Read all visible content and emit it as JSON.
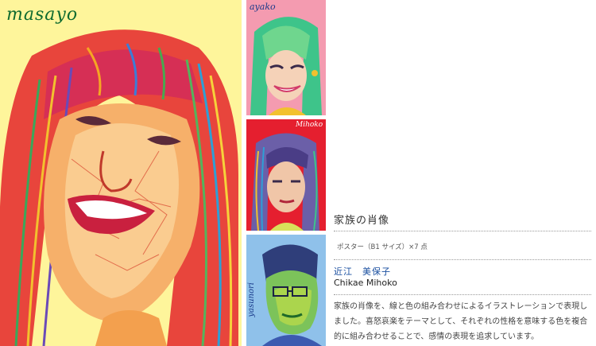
{
  "artworks": {
    "main_signature": "masayo",
    "panel1_signature": "ayako",
    "panel2_signature": "Mihoko",
    "panel3_signature": "yasunori"
  },
  "info": {
    "title": "家族の肖像",
    "spec": "ポスター（B1 サイズ）×7 点",
    "artist_name_jp": "近江　美保子",
    "artist_name_en": "Chikae Mihoko",
    "description": "家族の肖像を、線と色の組み合わせによるイラストレーションで表現しました。喜怒哀楽をテーマとして、それぞれの性格を意味する色を複合的に組み合わせることで、感情の表現を追求しています。"
  },
  "colors": {
    "main_bg": "#fef59b",
    "panel1_bg": "#f49bb0",
    "panel2_bg": "#e51f2f",
    "panel3_bg": "#8fc1ea",
    "name_accent": "#1a4fa0"
  }
}
